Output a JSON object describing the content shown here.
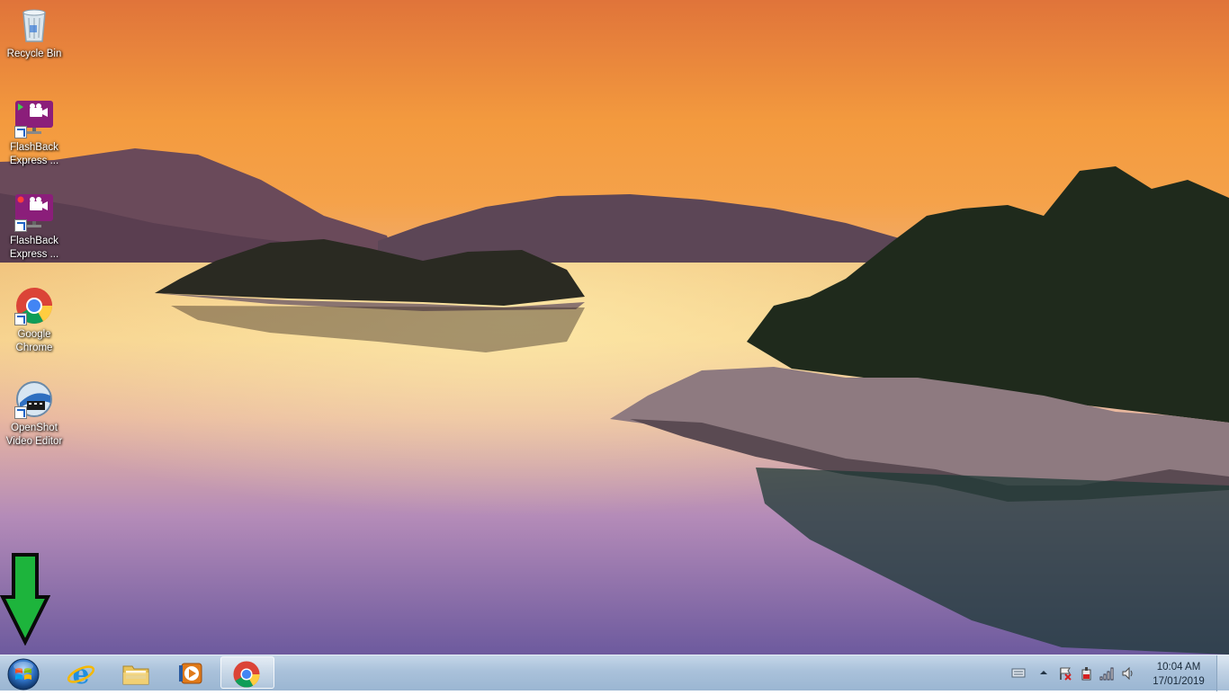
{
  "desktop": {
    "icons": [
      {
        "label": "Recycle Bin",
        "icon": "recycle-bin-icon"
      },
      {
        "label": "FlashBack\nExpress ...",
        "icon": "flashback-player-icon"
      },
      {
        "label": "FlashBack\nExpress ...",
        "icon": "flashback-recorder-icon"
      },
      {
        "label": "Google\nChrome",
        "icon": "chrome-icon"
      },
      {
        "label": "OpenShot\nVideo Editor",
        "icon": "openshot-icon"
      }
    ]
  },
  "annotation": {
    "icon": "green-down-arrow-icon",
    "color": "#1db43c"
  },
  "taskbar": {
    "pinned": [
      {
        "name": "internet-explorer",
        "icon": "internet-explorer-icon"
      },
      {
        "name": "windows-explorer",
        "icon": "folder-icon"
      },
      {
        "name": "media-player",
        "icon": "media-player-icon"
      },
      {
        "name": "google-chrome",
        "icon": "chrome-icon",
        "active": true
      }
    ],
    "tray": {
      "icons": [
        "keyboard-icon",
        "show-hidden-icons-chevron",
        "action-center-flag-icon",
        "power-icon",
        "network-signal-icon",
        "volume-icon"
      ]
    },
    "clock": {
      "time": "10:04 AM",
      "date": "17/01/2019"
    }
  }
}
